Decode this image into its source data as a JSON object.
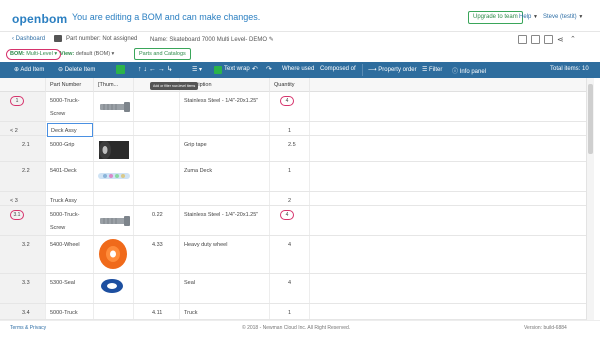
{
  "header": {
    "logo": "openbom",
    "message": "You are editing a BOM and can make changes.",
    "upgrade_label": "Upgrade to team",
    "help_label": "Help",
    "user_label": "Steve (testit)"
  },
  "infobar": {
    "dashboard": "Dashboard",
    "part_number": "Part number: Not assigned",
    "name": "Name: Skateboard 7000 Multi Level- DEMO"
  },
  "bomrow": {
    "bom_label": "BOM:",
    "bom_value": "Multi-Level",
    "view_label": "View:",
    "view_value": "default (BOM)",
    "parts_catalogs": "Parts and Catalogs"
  },
  "toolbar": {
    "add_item": "Add Item",
    "delete_item": "Delete Item",
    "arrows": "↑ ↓ ← → ↳",
    "text_wrap": "Text wrap",
    "undo": "↶",
    "redo": "↷",
    "where_used": "Where used",
    "composed_of": "Composed of",
    "property_order": "Property order",
    "filter": "Filter",
    "info_panel": "Info panel",
    "total_items": "Total items: 10",
    "tooltip": "Add or filter row-level items"
  },
  "columns": {
    "part_number": "Part Number",
    "thumbnail": "[Thum...",
    "description": "Description",
    "quantity": "Quantity"
  },
  "rows": [
    {
      "idx": "1",
      "part": "5000-Truck-",
      "part2": "Screw",
      "num": "",
      "desc": "Stainless Steel - 1/4\"-20x1.25\"",
      "qty": "4",
      "thumb": "screw"
    },
    {
      "idx": "< 2",
      "part": "Deck Assy",
      "part2": "",
      "num": "",
      "desc": "",
      "qty": "1",
      "thumb": ""
    },
    {
      "idx": "2.1",
      "part": "5000-Grip",
      "part2": "",
      "num": "",
      "desc": "Grip tape",
      "qty": "2.5",
      "thumb": "grip"
    },
    {
      "idx": "2.2",
      "part": "5401-Deck",
      "part2": "",
      "num": "",
      "desc": "Zuma Deck",
      "qty": "1",
      "thumb": "deck"
    },
    {
      "idx": "< 3",
      "part": "Truck Assy",
      "part2": "",
      "num": "",
      "desc": "",
      "qty": "2",
      "thumb": ""
    },
    {
      "idx": "3.1",
      "part": "5000-Truck-",
      "part2": "Screw",
      "num": "0.22",
      "desc": "Stainless Steel - 1/4\"-20x1.25\"",
      "qty": "4",
      "thumb": "screw"
    },
    {
      "idx": "3.2",
      "part": "5400-Wheel",
      "part2": "",
      "num": "4.33",
      "desc": "Heavy duty wheel",
      "qty": "4",
      "thumb": "wheel"
    },
    {
      "idx": "3.3",
      "part": "5300-Seal",
      "part2": "",
      "num": "",
      "desc": "Seal",
      "qty": "4",
      "thumb": "seal"
    },
    {
      "idx": "3.4",
      "part": "5000-Truck",
      "part2": "",
      "num": "4.11",
      "desc": "Truck",
      "qty": "1",
      "thumb": ""
    }
  ],
  "footer": {
    "terms": "Terms & Privacy",
    "copyright": "© 2018 - Newman Cloud Inc. All Right Reserved.",
    "version": "Version: build-6884"
  },
  "colors": {
    "brand_blue": "#2b7fc1",
    "toolbar_blue": "#2e6d9e",
    "green": "#2bb34a",
    "highlight_pink": "#d6336c"
  }
}
